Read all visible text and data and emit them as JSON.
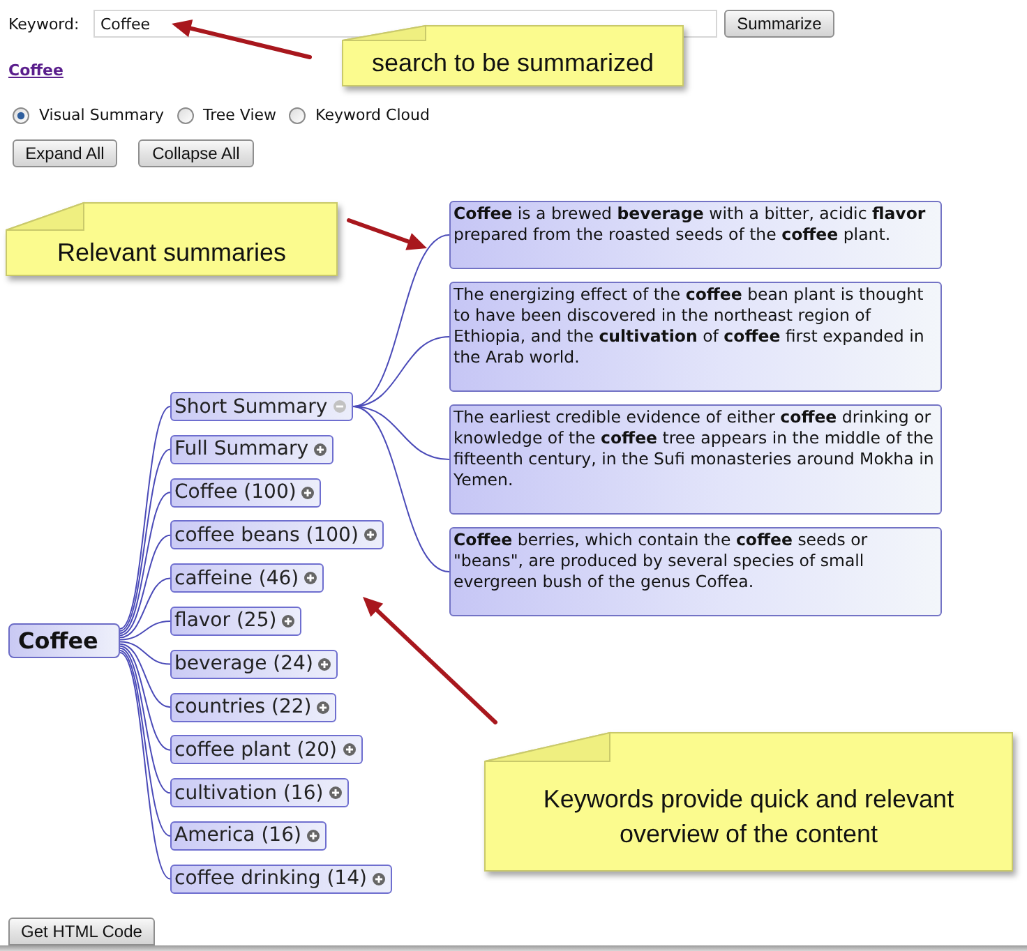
{
  "search": {
    "label": "Keyword:",
    "value": "Coffee",
    "button": "Summarize"
  },
  "result_link": "Coffee",
  "view_options": [
    {
      "label": "Visual Summary",
      "selected": true
    },
    {
      "label": "Tree View",
      "selected": false
    },
    {
      "label": "Keyword Cloud",
      "selected": false
    }
  ],
  "buttons": [
    "Expand All",
    "Collapse All"
  ],
  "mind_map": {
    "root": "Coffee",
    "nodes": [
      {
        "label": "Short Summary",
        "expanded": true,
        "children": [
          {
            "text": "**Coffee** is a brewed **beverage** with a bitter, acidic **flavor** prepared from the roasted seeds of the **coffee** plant."
          },
          {
            "text": "The energizing effect of the **coffee** bean plant is thought to have been discovered in the northeast region of Ethiopia, and the **cultivation** of **coffee** first expanded in the Arab world."
          },
          {
            "text": "The earliest credible evidence of either **coffee** drinking or knowledge of the **coffee** tree appears in the middle of the fifteenth century, in the Sufi monasteries around Mokha in Yemen."
          },
          {
            "text": "**Coffee** berries, which contain the **coffee** seeds or \"beans\", are produced by several species of small evergreen bush of the genus Coffea."
          }
        ]
      },
      {
        "label": "Full Summary",
        "expanded": false
      },
      {
        "label": "Coffee (100)",
        "expanded": false
      },
      {
        "label": "coffee beans (100)",
        "expanded": false
      },
      {
        "label": "caffeine (46)",
        "expanded": false
      },
      {
        "label": "flavor (25)",
        "expanded": false
      },
      {
        "label": "beverage (24)",
        "expanded": false
      },
      {
        "label": "countries (22)",
        "expanded": false
      },
      {
        "label": "coffee plant (20)",
        "expanded": false
      },
      {
        "label": "cultivation (16)",
        "expanded": false
      },
      {
        "label": "America (16)",
        "expanded": false
      },
      {
        "label": "coffee drinking (14)",
        "expanded": false
      }
    ]
  },
  "footer_button": "Get HTML Code",
  "annotations": [
    {
      "text": "search to be summarized"
    },
    {
      "text": "Relevant summaries"
    },
    {
      "text": "Keywords provide quick and relevant overview of the content"
    }
  ]
}
